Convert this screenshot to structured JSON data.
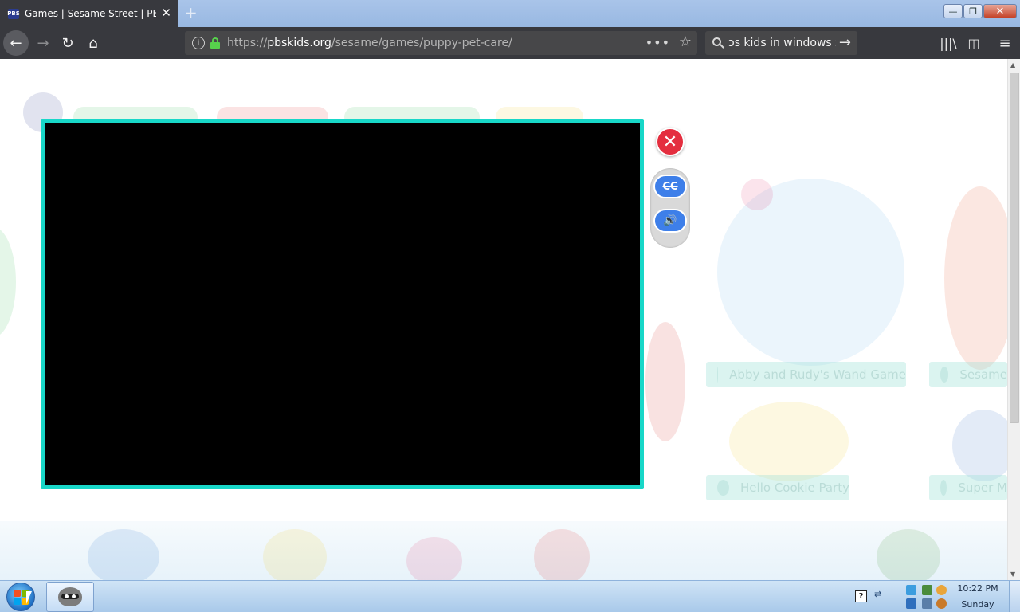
{
  "browser": {
    "tab": {
      "title": "Games | Sesame Street | PBS KIDS",
      "favicon": "PBS",
      "close_icon": "✕"
    },
    "new_tab_icon": "+",
    "window_controls": {
      "minimize": "—",
      "maximize": "❐",
      "close": "✕"
    },
    "nav": {
      "back": "←",
      "forward": "→",
      "reload": "↻",
      "home": "⌂"
    },
    "url": {
      "scheme": "https://",
      "host": "pbskids.org",
      "path": "/sesame/games/puppy-pet-care/",
      "info_icon": "i",
      "more_icon": "•••",
      "bookmark_icon": "☆"
    },
    "search": {
      "value": "ɔs kids in windows xp",
      "go_icon": "→"
    },
    "tools": {
      "library": "|||\\",
      "sidebar": "◫",
      "menu": "≡"
    }
  },
  "page": {
    "background_labels": [
      "Abby and Rudy's Wand Game",
      "Sesame",
      "Hello Cookie Party",
      "Super M"
    ],
    "game_modal": {
      "close_icon": "✕",
      "cc_label": "CC",
      "sound_icon": "🔊"
    },
    "colors": {
      "frame_border": "#18d7c8",
      "close_red": "#e42e3f",
      "control_blue": "#3e7fe9"
    }
  },
  "scrollbar": {
    "up": "▲",
    "down": "▼"
  },
  "taskbar": {
    "help_icon": "?",
    "tray_chevron": "⇄",
    "time": "10:22 PM",
    "day": "Sunday"
  }
}
